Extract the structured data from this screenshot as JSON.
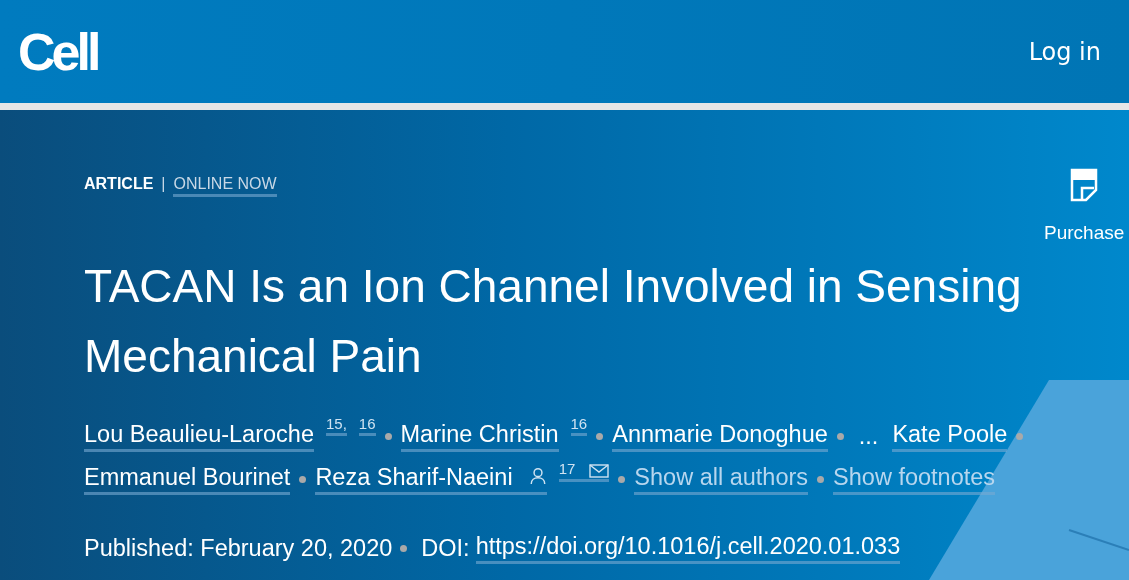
{
  "header": {
    "logo": "Cell",
    "login": "Log in"
  },
  "article": {
    "type": "ARTICLE",
    "separator": "|",
    "status": "ONLINE NOW",
    "title": "TACAN Is an Ion Channel Involved in Sensing Mechanical Pain",
    "authors": [
      {
        "kind": "author",
        "name": "Lou Beaulieu-Laroche",
        "sups": [
          "15,",
          "16"
        ]
      },
      {
        "kind": "author",
        "name": "Marine Christin",
        "sups": [
          "16"
        ]
      },
      {
        "kind": "author",
        "name": "Annmarie Donoghue"
      },
      {
        "kind": "ellipsis",
        "name": "..."
      },
      {
        "kind": "author",
        "name": "Kate Poole"
      },
      {
        "kind": "author",
        "name": "Emmanuel Bourinet"
      },
      {
        "kind": "author",
        "name": "Reza Sharif-Naeini",
        "sups": [
          "17"
        ],
        "contact": true
      },
      {
        "kind": "link",
        "name": "Show all authors"
      },
      {
        "kind": "link",
        "name": "Show footnotes"
      }
    ],
    "published": "Published: February 20, 2020",
    "doi_label": "DOI:",
    "doi": "https://doi.org/10.1016/j.cell.2020.01.033"
  },
  "aside": {
    "purchase": "Purchase"
  }
}
